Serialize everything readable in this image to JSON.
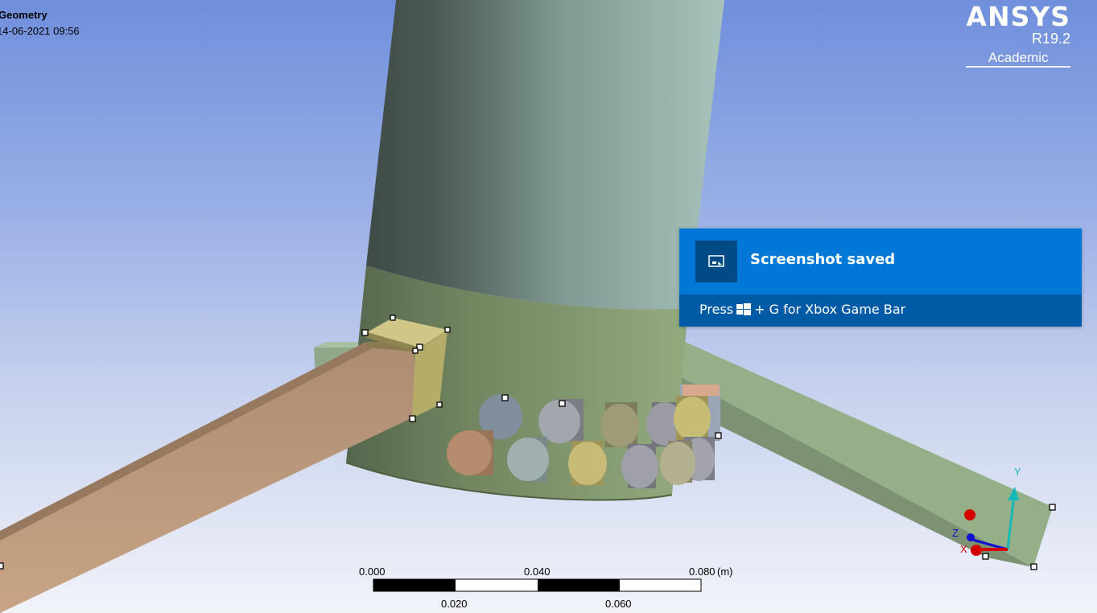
{
  "viewport": {
    "title": "Geometry",
    "timestamp": "14-06-2021 09:56"
  },
  "logo": {
    "brand": "ANSYS",
    "version": "R19.2",
    "edition": "Academic"
  },
  "toast": {
    "title": "Screenshot saved",
    "message_prefix": "Press",
    "message_suffix": "+ G for Xbox Game Bar",
    "accent": "#0078d7",
    "footer_color": "#005ba6",
    "icon": "screenshot-icon",
    "key_icon": "windows-key-icon"
  },
  "scale_bar": {
    "top_labels": [
      "0.000",
      "0.040",
      "0.080"
    ],
    "bottom_labels": [
      "0.020",
      "0.060"
    ],
    "unit": "(m)"
  },
  "triad": {
    "y": "Y",
    "z": "Z",
    "x": "X"
  }
}
